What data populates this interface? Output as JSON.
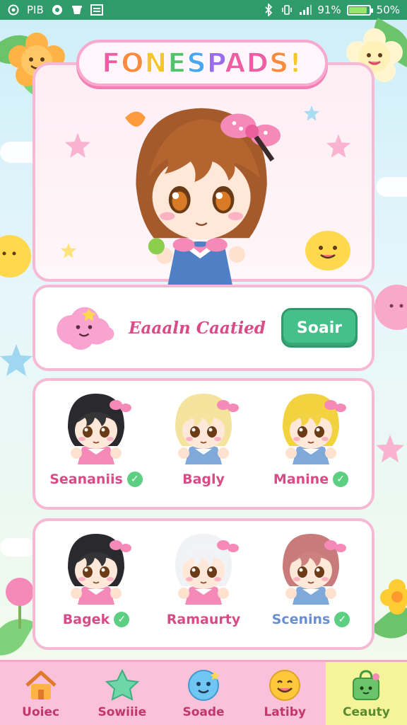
{
  "status_bar": {
    "left_text": "PIB",
    "signal_text": "91%",
    "battery_text": "50%",
    "battery_level": 0.9
  },
  "app": {
    "title": "FONESPADS!",
    "title_colors": [
      "#f15da5",
      "#ff8a3d",
      "#f6c626",
      "#53c26c",
      "#4aa6ee",
      "#9a6bea",
      "#f15da5"
    ]
  },
  "profile": {
    "name": "Eaaaln Caatied",
    "scan_button": "Soair"
  },
  "characters": [
    {
      "name": "Seananiis",
      "hair": "#2a2a2e",
      "outfit": "#f58ab8",
      "label_color": "#d94b86",
      "checked": true
    },
    {
      "name": "Bagly",
      "hair": "#f4e39c",
      "outfit": "#7ea9d9",
      "label_color": "#d94b86",
      "checked": false
    },
    {
      "name": "Manine",
      "hair": "#f2d23e",
      "outfit": "#7ea9d9",
      "label_color": "#d94b86",
      "checked": true
    },
    {
      "name": "Bagek",
      "hair": "#2a2a2e",
      "outfit": "#f58ab8",
      "label_color": "#d94b86",
      "checked": true
    },
    {
      "name": "Ramaurty",
      "hair": "#f1f2f5",
      "outfit": "#f58ab8",
      "label_color": "#d94b86",
      "checked": false
    },
    {
      "name": "Scenins",
      "hair": "#c97a7a",
      "outfit": "#7ea9d9",
      "label_color": "#6a8fd0",
      "checked": true
    }
  ],
  "nav": [
    {
      "label": "Uoiec",
      "icon": "house-icon"
    },
    {
      "label": "Sowiiie",
      "icon": "star-icon"
    },
    {
      "label": "Soade",
      "icon": "bubble-face-icon"
    },
    {
      "label": "Latiby",
      "icon": "smiley-icon"
    },
    {
      "label": "Ceauty",
      "icon": "bag-icon"
    }
  ],
  "colors": {
    "status_bar": "#2f9a6a",
    "accent_pink": "#f6b9d4",
    "button_green": "#45c08a"
  }
}
